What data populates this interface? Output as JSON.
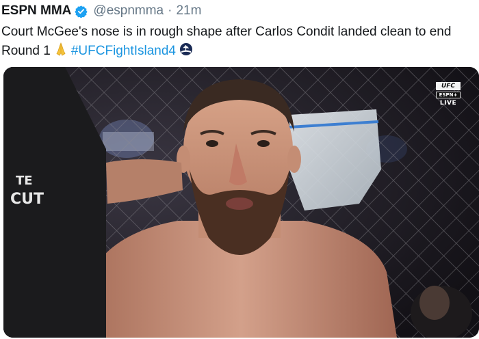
{
  "tweet": {
    "author_name": "ESPN MMA",
    "handle": "@espnmma",
    "separator": "·",
    "time_ago": "21m",
    "text_main": "Court McGee's nose is in rough shape after Carlos Condit landed clean to end Round 1",
    "emoji": "folded-hands-emoji",
    "hashtag": "#UFCFightIsland4",
    "hashflag_icon": "ufc-fight-island-hashflag-icon"
  },
  "media": {
    "alt": "Bearded fighter sitting in the cage corner with an ice bag held to his neck",
    "broadcast_bug": {
      "logo": "UFC",
      "network": "ESPN+",
      "status": "LIVE"
    },
    "shirt_text_1": "TE",
    "shirt_text_2": "CUT"
  },
  "colors": {
    "verified": "#1da1f2",
    "hashtag": "#1b95e0",
    "handle": "#657786"
  }
}
